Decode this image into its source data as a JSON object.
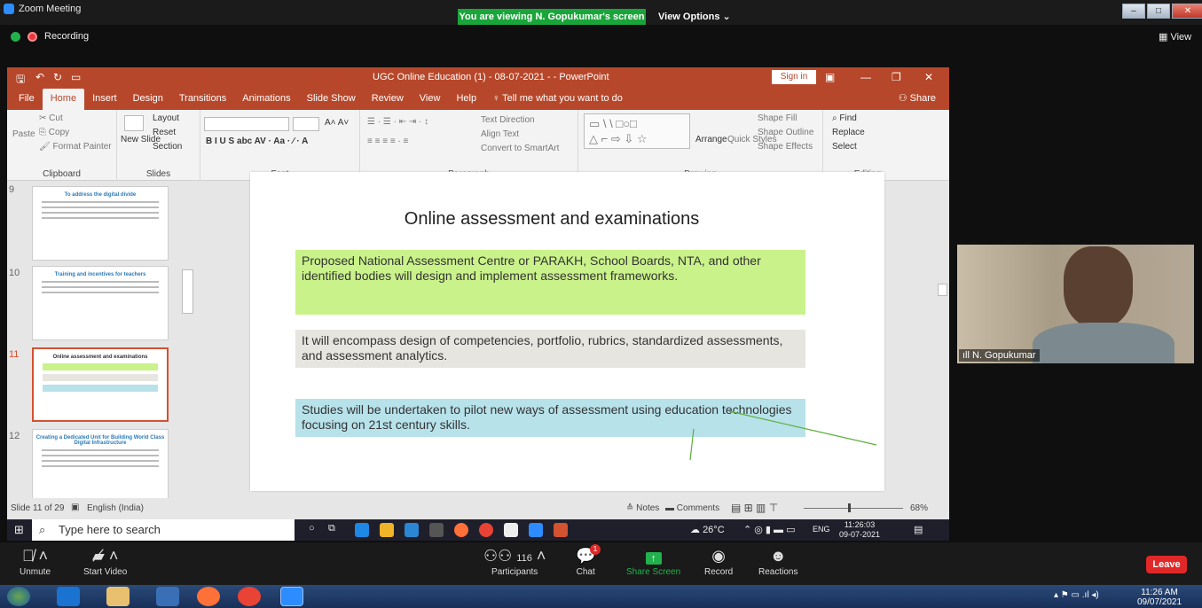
{
  "zoom": {
    "window_title": "Zoom Meeting",
    "viewing_banner": "You are viewing N. Gopukumar's screen",
    "view_options": "View Options ⌄",
    "recording": "Recording",
    "view_label": "View",
    "participant_name": "N. Gopukumar",
    "controls": {
      "unmute": "Unmute",
      "start_video": "Start Video",
      "participants": "Participants",
      "participants_count": "116",
      "chat": "Chat",
      "chat_badge": "1",
      "share_screen": "Share Screen",
      "record": "Record",
      "reactions": "Reactions",
      "leave": "Leave"
    }
  },
  "ppt": {
    "title": "UGC Online Education (1) - 08-07-2021 -  -  PowerPoint",
    "sign_in": "Sign in",
    "share": "Share",
    "tabs": [
      "File",
      "Home",
      "Insert",
      "Design",
      "Transitions",
      "Animations",
      "Slide Show",
      "Review",
      "View",
      "Help"
    ],
    "tell_me": "Tell me what you want to do",
    "ribbon": {
      "clipboard": {
        "label": "Clipboard",
        "paste": "Paste",
        "cut": "Cut",
        "copy": "Copy",
        "format_painter": "Format Painter"
      },
      "slides": {
        "label": "Slides",
        "new_slide": "New Slide",
        "layout": "Layout",
        "reset": "Reset",
        "section": "Section"
      },
      "font": {
        "label": "Font"
      },
      "paragraph": {
        "label": "Paragraph",
        "text_direction": "Text Direction",
        "align_text": "Align Text",
        "smartart": "Convert to SmartArt"
      },
      "drawing": {
        "label": "Drawing",
        "arrange": "Arrange",
        "quick_styles": "Quick Styles",
        "shape_fill": "Shape Fill",
        "shape_outline": "Shape Outline",
        "shape_effects": "Shape Effects"
      },
      "editing": {
        "label": "Editing",
        "find": "Find",
        "replace": "Replace",
        "select": "Select"
      }
    },
    "thumbs": [
      {
        "num": "9",
        "title": "To address the digital divide"
      },
      {
        "num": "10",
        "title": "Training and incentives for teachers"
      },
      {
        "num": "11",
        "title": "Online assessment and examinations"
      },
      {
        "num": "12",
        "title": "Creating a Dedicated Unit for Building World Class Digital Infrastructure"
      }
    ],
    "slide": {
      "title": "Online assessment and examinations",
      "box1": "Proposed National Assessment Centre or PARAKH, School Boards, NTA, and other identified bodies will design and implement assessment frameworks.",
      "box2": "It will encompass design of competencies, portfolio, rubrics, standardized assessments, and assessment analytics.",
      "box3": "Studies will be undertaken to pilot new ways of assessment using education technologies focusing on 21st century skills."
    },
    "status": {
      "slide_of": "Slide 11 of 29",
      "language": "English (India)",
      "notes": "Notes",
      "comments": "Comments",
      "zoom": "68%"
    },
    "taskbar": {
      "search": "Type here to search",
      "temp": "26°C",
      "lang": "ENG",
      "time": "11:26:03",
      "date": "09-07-2021"
    }
  },
  "host_taskbar": {
    "time": "11:26 AM",
    "date": "09/07/2021"
  }
}
